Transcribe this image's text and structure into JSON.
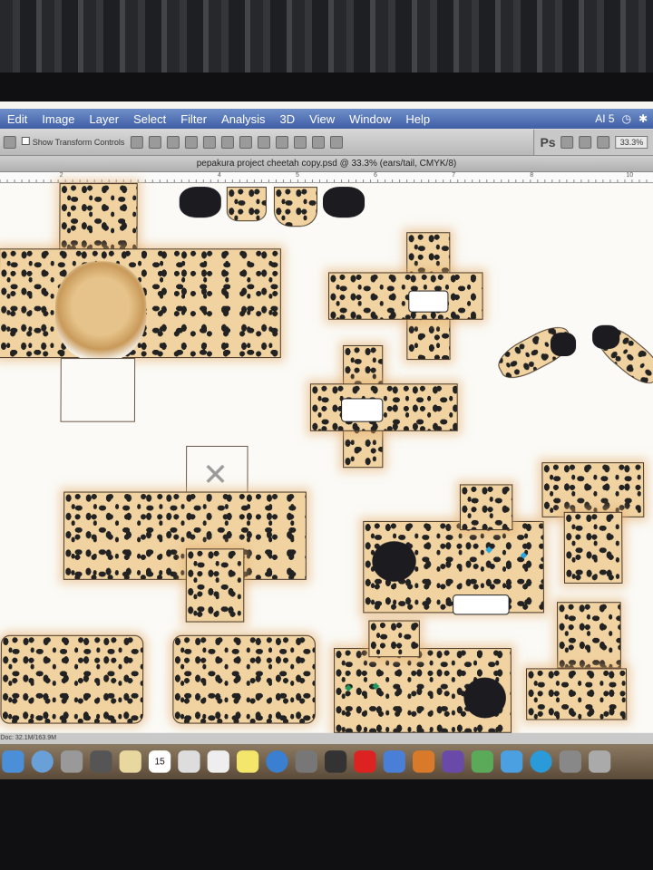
{
  "app": {
    "menus": [
      "Edit",
      "Image",
      "Layer",
      "Select",
      "Filter",
      "Analysis",
      "3D",
      "View",
      "Window",
      "Help"
    ],
    "status_right": {
      "badge": "AI 5",
      "clock_icon": "clock-icon",
      "bt_icon": "bluetooth-icon"
    }
  },
  "options_bar": {
    "show_transform_controls": "Show Transform Controls",
    "ps_logo": "Ps",
    "zoom_value": "33.3%"
  },
  "document": {
    "tab_title": "pepakura project cheetah copy.psd @ 33.3% (ears/tail, CMYK/8)",
    "ruler_numbers": [
      "2",
      "4",
      "5",
      "6",
      "7",
      "8",
      "10"
    ],
    "status_text": "Doc: 32.1M/163.9M"
  },
  "dock": {
    "calendar_day": "15",
    "icons": [
      "finder-icon",
      "safari-icon",
      "mail-icon",
      "facetime-icon",
      "notes-icon",
      "calendar-icon",
      "imovie-icon",
      "textedit-icon",
      "stickies-icon",
      "itunes-icon",
      "preview-icon",
      "photobooth-icon",
      "app-icon",
      "office-word-icon",
      "office-powerpoint-icon",
      "office-excel-icon",
      "messenger-icon",
      "app-store-icon",
      "skype-icon",
      "system-prefs-icon",
      "trash-icon"
    ]
  },
  "colors": {
    "menubar": "#3f5ea6",
    "fur": "#f1d3a2",
    "spot": "#222222"
  }
}
